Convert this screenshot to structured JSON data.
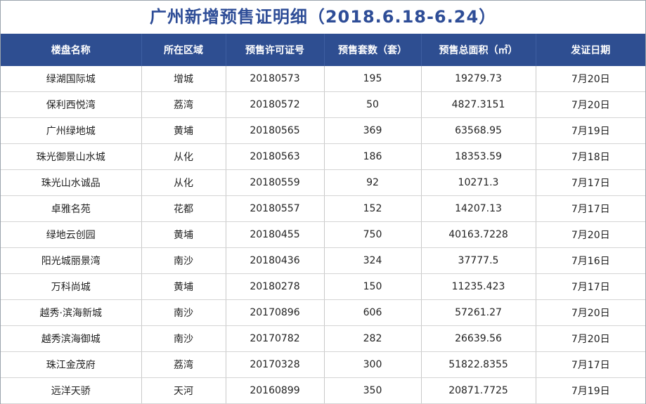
{
  "title": "广州新增预售证明细（2018.6.18-6.24）",
  "columns": [
    "楼盘名称",
    "所在区域",
    "预售许可证号",
    "预售套数（套）",
    "预售总面积（㎡）",
    "发证日期"
  ],
  "rows": [
    [
      "绿湖国际城",
      "增城",
      "20180573",
      "195",
      "19279.73",
      "7月20日"
    ],
    [
      "保利西悦湾",
      "荔湾",
      "20180572",
      "50",
      "4827.3151",
      "7月20日"
    ],
    [
      "广州绿地城",
      "黄埔",
      "20180565",
      "369",
      "63568.95",
      "7月19日"
    ],
    [
      "珠光御景山水城",
      "从化",
      "20180563",
      "186",
      "18353.59",
      "7月18日"
    ],
    [
      "珠光山水诚品",
      "从化",
      "20180559",
      "92",
      "10271.3",
      "7月17日"
    ],
    [
      "卓雅名苑",
      "花都",
      "20180557",
      "152",
      "14207.13",
      "7月17日"
    ],
    [
      "绿地云创园",
      "黄埔",
      "20180455",
      "750",
      "40163.7228",
      "7月20日"
    ],
    [
      "阳光城丽景湾",
      "南沙",
      "20180436",
      "324",
      "37777.5",
      "7月16日"
    ],
    [
      "万科尚城",
      "黄埔",
      "20180278",
      "150",
      "11235.423",
      "7月17日"
    ],
    [
      "越秀·滨海新城",
      "南沙",
      "20170896",
      "606",
      "57261.27",
      "7月20日"
    ],
    [
      "越秀滨海御城",
      "南沙",
      "20170782",
      "282",
      "26639.56",
      "7月20日"
    ],
    [
      "珠江金茂府",
      "荔湾",
      "20170328",
      "300",
      "51822.8355",
      "7月17日"
    ],
    [
      "远洋天骄",
      "天河",
      "20160899",
      "350",
      "20871.7725",
      "7月19日"
    ]
  ]
}
